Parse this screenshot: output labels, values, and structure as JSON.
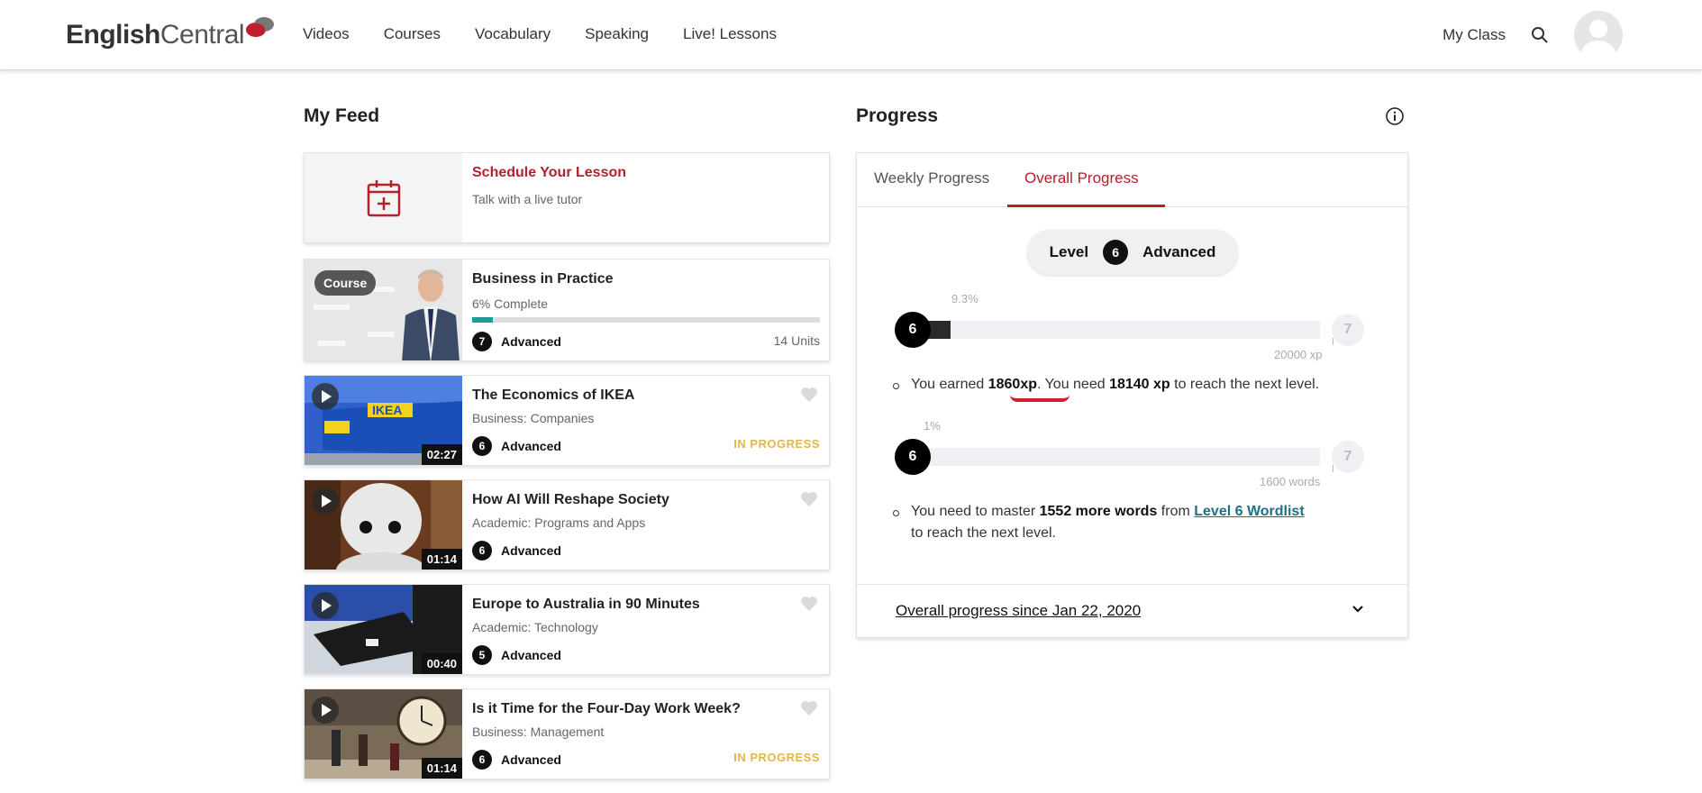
{
  "nav": {
    "logo_bold": "English",
    "logo_rest": "Central",
    "links": [
      "Videos",
      "Courses",
      "Vocabulary",
      "Speaking",
      "Live! Lessons"
    ],
    "my_class": "My Class"
  },
  "feed": {
    "title": "My Feed",
    "schedule": {
      "title": "Schedule Your Lesson",
      "subtitle": "Talk with a live tutor"
    },
    "course": {
      "badge": "Course",
      "title": "Business in Practice",
      "complete_text": "6% Complete",
      "progress": 0.06,
      "level": "7",
      "level_name": "Advanced",
      "units": "14 Units"
    },
    "videos": [
      {
        "title": "The Economics of IKEA",
        "category": "Business: Companies",
        "level": "6",
        "level_name": "Advanced",
        "duration": "02:27",
        "status": "IN PROGRESS"
      },
      {
        "title": "How AI Will Reshape Society",
        "category": "Academic: Programs and Apps",
        "level": "6",
        "level_name": "Advanced",
        "duration": "01:14",
        "status": ""
      },
      {
        "title": "Europe to Australia in 90 Minutes",
        "category": "Academic: Technology",
        "level": "5",
        "level_name": "Advanced",
        "duration": "00:40",
        "status": ""
      },
      {
        "title": "Is it Time for the Four-Day Work Week?",
        "category": "Business: Management",
        "level": "6",
        "level_name": "Advanced",
        "duration": "01:14",
        "status": "IN PROGRESS"
      }
    ]
  },
  "progress": {
    "title": "Progress",
    "tabs": [
      "Weekly Progress",
      "Overall Progress"
    ],
    "active_tab": "Overall Progress",
    "level_label": "Level",
    "level_num": "6",
    "level_name": "Advanced",
    "xp_bar": {
      "pct_label": "9.3%",
      "fraction": 0.093,
      "from": "6",
      "to": "7",
      "goal": "20000 xp"
    },
    "xp_text": {
      "a": "You earned ",
      "b": "1860xp",
      "c": ". You need ",
      "d": "18140 xp",
      "e": " to reach the next level."
    },
    "words_bar": {
      "pct_label": "1%",
      "fraction": 0.01,
      "from": "6",
      "to": "7",
      "goal": "1600 words"
    },
    "words_text": {
      "a": "You need to master ",
      "b": "1552 more words",
      "c": " from ",
      "link": "Level 6 Wordlist",
      "d": "to reach the next level."
    },
    "since_label": "Overall progress since Jan 22, 2020"
  },
  "colors": {
    "brand_red": "#b2212d",
    "teal": "#1e9e92",
    "in_progress": "#e3b64a",
    "link": "#1f6f86"
  }
}
